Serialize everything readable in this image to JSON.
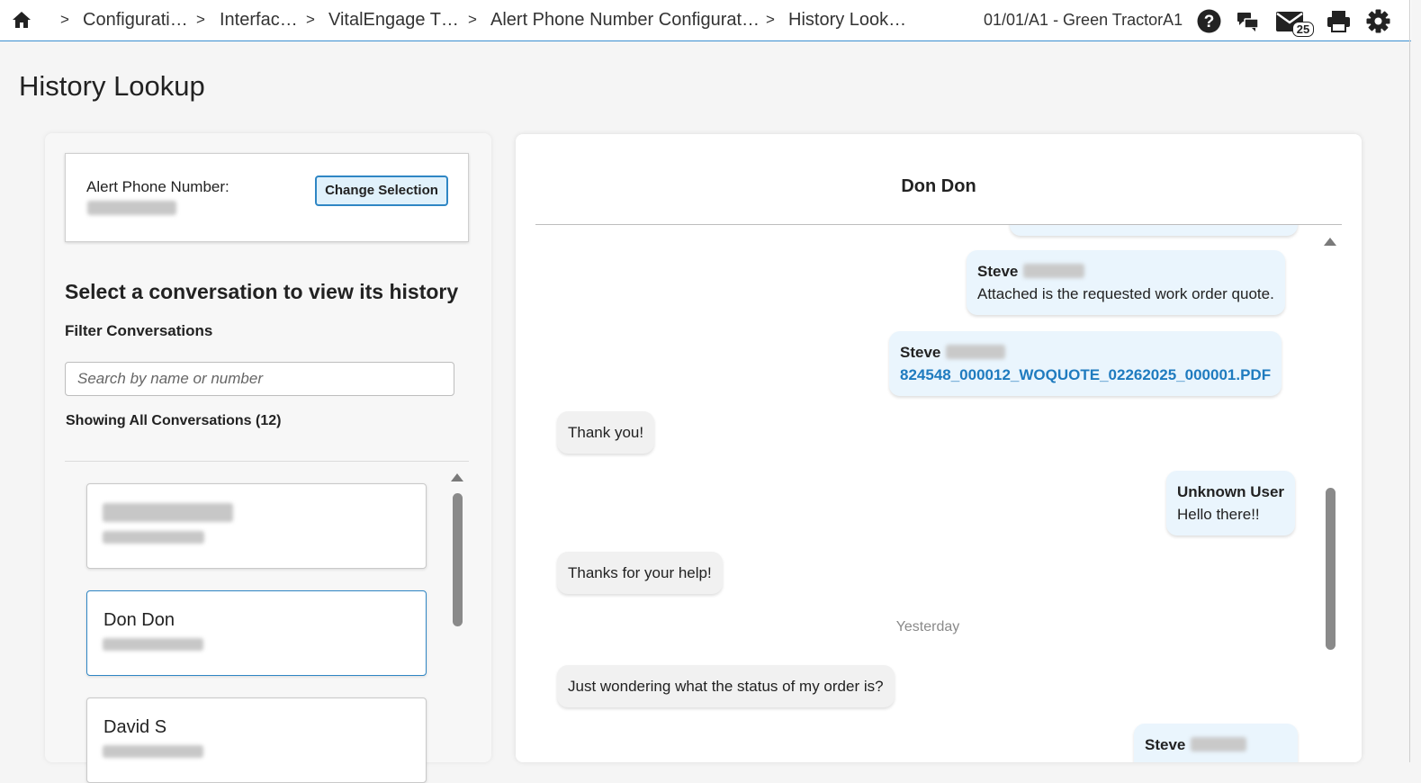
{
  "topbar": {
    "breadcrumbs": [
      "Configurati…",
      "Interfac…",
      "VitalEngage T…",
      "Alert Phone Number Configurat…",
      "History Look…"
    ],
    "separator": ">",
    "location": "01/01/A1 - Green TractorA1",
    "mail_count": "25",
    "icons": [
      "home-icon",
      "help-icon",
      "chat-icon",
      "mail-icon",
      "print-icon",
      "gear-icon"
    ]
  },
  "page": {
    "title": "History Lookup"
  },
  "left_panel": {
    "alert_label": "Alert Phone Number:",
    "change_button": "Change Selection",
    "select_heading": "Select a conversation to view its history",
    "filter_label": "Filter Conversations",
    "search_placeholder": "Search by name or number",
    "showing_text": "Showing All Conversations (12)",
    "conversations": [
      {
        "name": "",
        "selected": false
      },
      {
        "name": "Don Don",
        "selected": true
      },
      {
        "name": "David S",
        "selected": false
      }
    ]
  },
  "conversation": {
    "title": "Don Don",
    "messages": [
      {
        "direction": "out",
        "sender": "Steve",
        "text": "Attached is the requested work order quote."
      },
      {
        "direction": "out",
        "sender": "Steve",
        "attachment": "824548_000012_WOQUOTE_02262025_000001.PDF"
      },
      {
        "direction": "in",
        "text": "Thank you!"
      },
      {
        "direction": "out",
        "sender": "Unknown User",
        "text": "Hello there!!"
      },
      {
        "direction": "in",
        "text": "Thanks for your help!"
      },
      {
        "direction": "in",
        "text": "Just wondering what the status of my order is?"
      },
      {
        "direction": "out",
        "sender": "Steve",
        "text": ""
      }
    ],
    "day_separator": "Yesterday"
  },
  "colors": {
    "accent": "#2f86c4",
    "link": "#1f7bbf",
    "outgoing_bubble": "#eaf5fd",
    "incoming_bubble": "#f1f1f1"
  }
}
